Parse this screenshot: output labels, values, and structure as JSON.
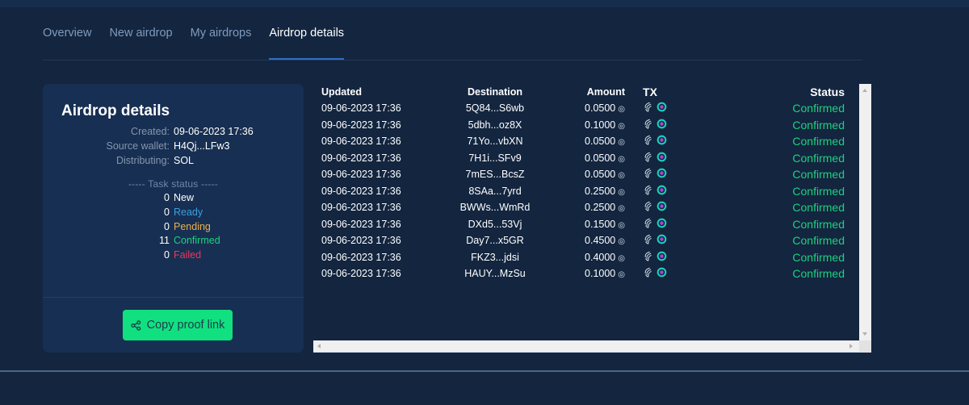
{
  "tabs": [
    {
      "label": "Overview",
      "active": false
    },
    {
      "label": "New airdrop",
      "active": false
    },
    {
      "label": "My airdrops",
      "active": false
    },
    {
      "label": "Airdrop details",
      "active": true
    }
  ],
  "details": {
    "title": "Airdrop details",
    "info": [
      {
        "label": "Created:",
        "value": "09-06-2023 17:36"
      },
      {
        "label": "Source wallet:",
        "value": "H4Qj...LFw3"
      },
      {
        "label": "Distributing:",
        "value": "SOL"
      }
    ],
    "task_status_heading": "----- Task status -----",
    "task_status": [
      {
        "count": "0",
        "label": "New",
        "color": "#ffffff"
      },
      {
        "count": "0",
        "label": "Ready",
        "color": "#3aa0e0"
      },
      {
        "count": "0",
        "label": "Pending",
        "color": "#e9b04e"
      },
      {
        "count": "11",
        "label": "Confirmed",
        "color": "#1fd17f"
      },
      {
        "count": "0",
        "label": "Failed",
        "color": "#e83a5e"
      }
    ],
    "copy_button_label": "Copy proof link",
    "copy_button_icon": "share-icon"
  },
  "table": {
    "headers": {
      "updated": "Updated",
      "destination": "Destination",
      "amount": "Amount",
      "tx": "TX",
      "status": "Status"
    },
    "currency_symbol": "◎",
    "tx_icons": [
      "solscan-icon",
      "solana-explorer-icon"
    ],
    "rows": [
      {
        "updated": "09-06-2023 17:36",
        "destination": "5Q84...S6wb",
        "amount": "0.0500",
        "status": "Confirmed"
      },
      {
        "updated": "09-06-2023 17:36",
        "destination": "5dbh...oz8X",
        "amount": "0.1000",
        "status": "Confirmed"
      },
      {
        "updated": "09-06-2023 17:36",
        "destination": "71Yo...vbXN",
        "amount": "0.0500",
        "status": "Confirmed"
      },
      {
        "updated": "09-06-2023 17:36",
        "destination": "7H1i...SFv9",
        "amount": "0.0500",
        "status": "Confirmed"
      },
      {
        "updated": "09-06-2023 17:36",
        "destination": "7mES...BcsZ",
        "amount": "0.0500",
        "status": "Confirmed"
      },
      {
        "updated": "09-06-2023 17:36",
        "destination": "8SAa...7yrd",
        "amount": "0.2500",
        "status": "Confirmed"
      },
      {
        "updated": "09-06-2023 17:36",
        "destination": "BWWs...WmRd",
        "amount": "0.2500",
        "status": "Confirmed"
      },
      {
        "updated": "09-06-2023 17:36",
        "destination": "DXd5...53Vj",
        "amount": "0.1500",
        "status": "Confirmed"
      },
      {
        "updated": "09-06-2023 17:36",
        "destination": "Day7...x5GR",
        "amount": "0.4500",
        "status": "Confirmed"
      },
      {
        "updated": "09-06-2023 17:36",
        "destination": "FKZ3...jdsi",
        "amount": "0.4000",
        "status": "Confirmed"
      },
      {
        "updated": "09-06-2023 17:36",
        "destination": "HAUY...MzSu",
        "amount": "0.1000",
        "status": "Confirmed"
      }
    ]
  }
}
